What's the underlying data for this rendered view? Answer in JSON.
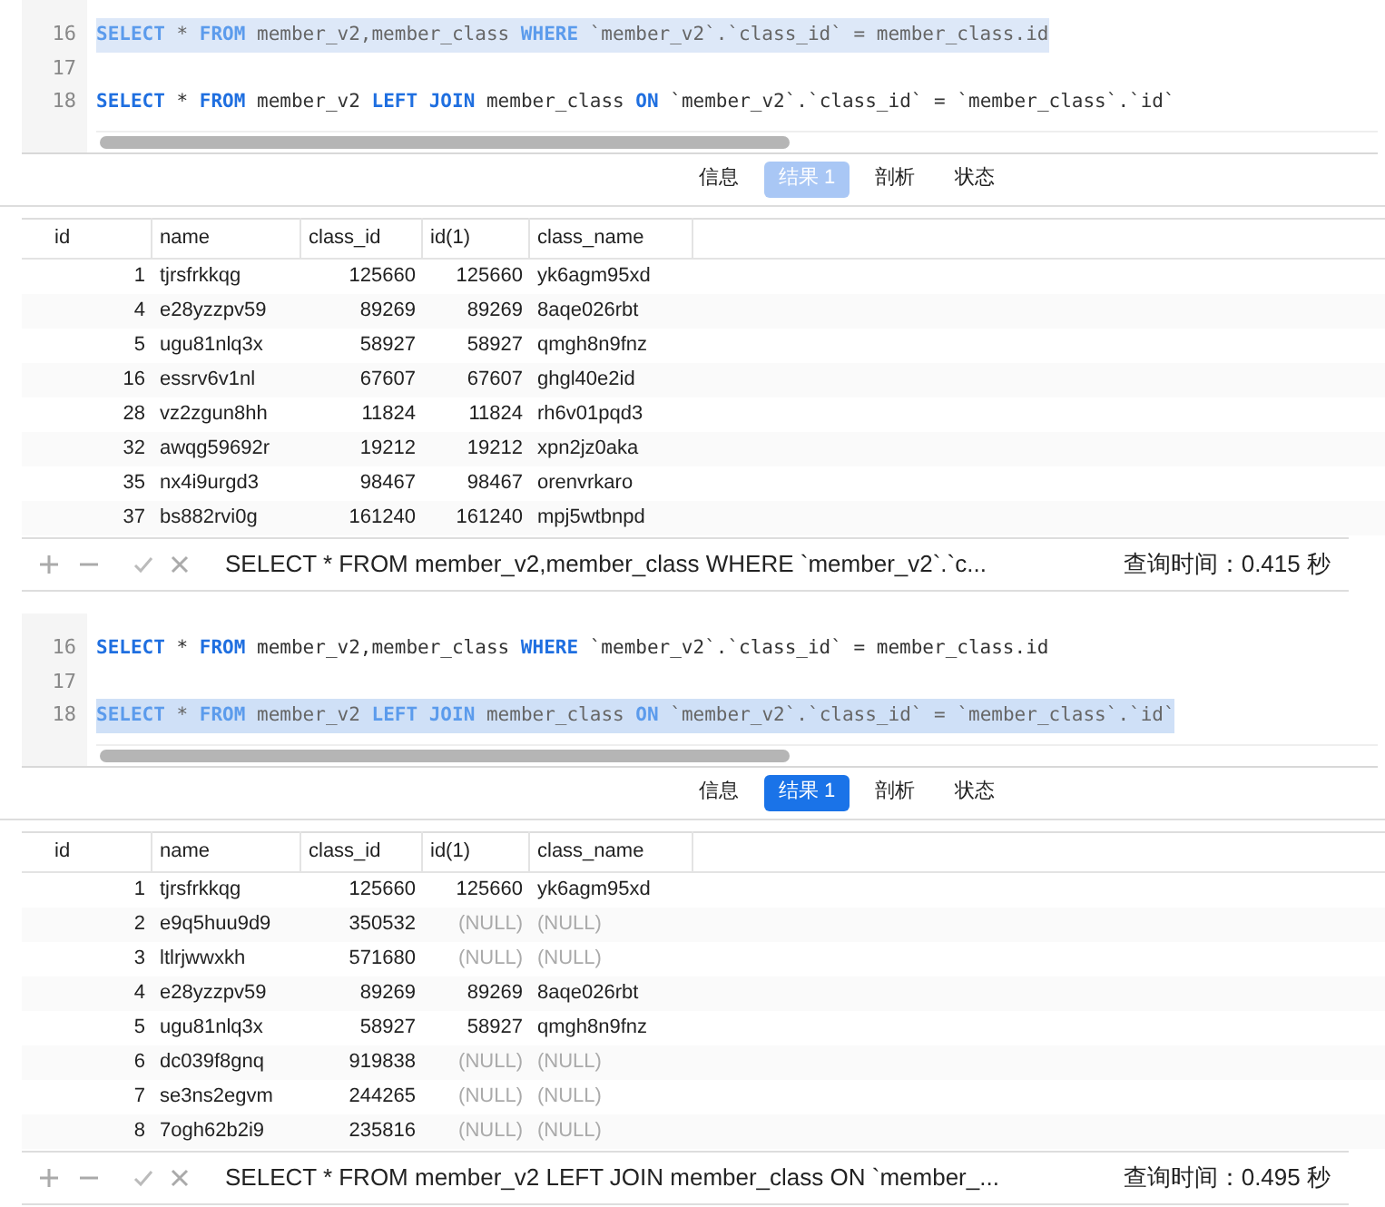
{
  "panels": [
    {
      "active": false,
      "code_lines": [
        {
          "number": "16",
          "selected": true,
          "tokens": [
            {
              "text": "SELECT",
              "kind": "keyword"
            },
            {
              "text": " * ",
              "kind": "plain"
            },
            {
              "text": "FROM",
              "kind": "keyword"
            },
            {
              "text": " member_v2,member_class ",
              "kind": "plain"
            },
            {
              "text": "WHERE",
              "kind": "keyword"
            },
            {
              "text": " `member_v2`.`class_id` = member_class.id",
              "kind": "plain"
            }
          ]
        },
        {
          "number": "17"
        },
        {
          "number": "18",
          "selected": false,
          "tokens": [
            {
              "text": "SELECT",
              "kind": "keyword"
            },
            {
              "text": " * ",
              "kind": "plain"
            },
            {
              "text": "FROM",
              "kind": "keyword"
            },
            {
              "text": " member_v2 ",
              "kind": "plain"
            },
            {
              "text": "LEFT JOIN",
              "kind": "keyword"
            },
            {
              "text": " member_class ",
              "kind": "plain"
            },
            {
              "text": "ON",
              "kind": "keyword"
            },
            {
              "text": " `member_v2`.`class_id` = `member_class`.`id`",
              "kind": "plain"
            }
          ]
        }
      ],
      "tabs": [
        {
          "label": "信息",
          "selected": false
        },
        {
          "label": "结果 1",
          "selected": true
        },
        {
          "label": "剖析",
          "selected": false
        },
        {
          "label": "状态",
          "selected": false
        }
      ],
      "columns": [
        "id",
        "name",
        "class_id",
        "id(1)",
        "class_name"
      ],
      "rows": [
        [
          "1",
          "tjrsfrkkqg",
          "125660",
          "125660",
          "yk6agm95xd"
        ],
        [
          "4",
          "e28yzzpv59",
          "89269",
          "89269",
          "8aqe026rbt"
        ],
        [
          "5",
          "ugu81nlq3x",
          "58927",
          "58927",
          "qmgh8n9fnz"
        ],
        [
          "16",
          "essrv6v1nl",
          "67607",
          "67607",
          "ghgl40e2id"
        ],
        [
          "28",
          "vz2zgun8hh",
          "11824",
          "11824",
          "rh6v01pqd3"
        ],
        [
          "32",
          "awqg59692r",
          "19212",
          "19212",
          "xpn2jz0aka"
        ],
        [
          "35",
          "nx4i9urgd3",
          "98467",
          "98467",
          "orenvrkaro"
        ],
        [
          "37",
          "bs882rvi0g",
          "161240",
          "161240",
          "mpj5wtbnpd"
        ]
      ],
      "status": {
        "query": "SELECT * FROM member_v2,member_class WHERE `member_v2`.`c...",
        "time": "查询时间：0.415 秒"
      }
    },
    {
      "active": true,
      "code_lines": [
        {
          "number": "16",
          "selected": false,
          "tokens": [
            {
              "text": "SELECT",
              "kind": "keyword"
            },
            {
              "text": " * ",
              "kind": "plain"
            },
            {
              "text": "FROM",
              "kind": "keyword"
            },
            {
              "text": " member_v2,member_class ",
              "kind": "plain"
            },
            {
              "text": "WHERE",
              "kind": "keyword"
            },
            {
              "text": " `member_v2`.`class_id` = member_class.id",
              "kind": "plain"
            }
          ]
        },
        {
          "number": "17"
        },
        {
          "number": "18",
          "selected": true,
          "tokens": [
            {
              "text": "SELECT",
              "kind": "keyword"
            },
            {
              "text": " * ",
              "kind": "plain"
            },
            {
              "text": "FROM",
              "kind": "keyword"
            },
            {
              "text": " member_v2 ",
              "kind": "plain"
            },
            {
              "text": "LEFT JOIN",
              "kind": "keyword"
            },
            {
              "text": " member_class ",
              "kind": "plain"
            },
            {
              "text": "ON",
              "kind": "keyword"
            },
            {
              "text": " `member_v2`.`class_id` = `member_class`.`id`",
              "kind": "plain"
            }
          ]
        }
      ],
      "tabs": [
        {
          "label": "信息",
          "selected": false
        },
        {
          "label": "结果 1",
          "selected": true
        },
        {
          "label": "剖析",
          "selected": false
        },
        {
          "label": "状态",
          "selected": false
        }
      ],
      "columns": [
        "id",
        "name",
        "class_id",
        "id(1)",
        "class_name"
      ],
      "rows": [
        [
          "1",
          "tjrsfrkkqg",
          "125660",
          "125660",
          "yk6agm95xd"
        ],
        [
          "2",
          "e9q5huu9d9",
          "350532",
          "(NULL)",
          "(NULL)"
        ],
        [
          "3",
          "ltlrjwwxkh",
          "571680",
          "(NULL)",
          "(NULL)"
        ],
        [
          "4",
          "e28yzzpv59",
          "89269",
          "89269",
          "8aqe026rbt"
        ],
        [
          "5",
          "ugu81nlq3x",
          "58927",
          "58927",
          "qmgh8n9fnz"
        ],
        [
          "6",
          "dc039f8gnq",
          "919838",
          "(NULL)",
          "(NULL)"
        ],
        [
          "7",
          "se3ns2egvm",
          "244265",
          "(NULL)",
          "(NULL)"
        ],
        [
          "8",
          "7ogh62b2i9",
          "235816",
          "(NULL)",
          "(NULL)"
        ]
      ],
      "status": {
        "query": "SELECT * FROM member_v2 LEFT JOIN member_class ON `member_...",
        "time": "查询时间：0.495 秒"
      }
    }
  ]
}
